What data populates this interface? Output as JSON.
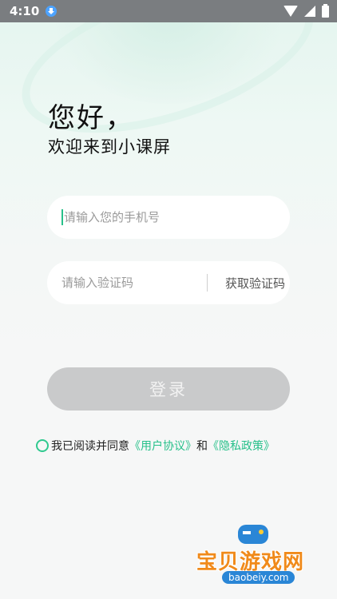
{
  "status_bar": {
    "time": "4:10",
    "icons": [
      "download-icon",
      "wifi-icon",
      "signal-icon",
      "battery-icon"
    ]
  },
  "greeting": "您好，",
  "subtitle": "欢迎来到小课屏",
  "phone_field": {
    "placeholder": "请输入您的手机号",
    "value": ""
  },
  "code_field": {
    "placeholder": "请输入验证码",
    "value": "",
    "get_code_label": "获取验证码"
  },
  "login_button": {
    "label": "登录"
  },
  "agreement": {
    "checked": false,
    "prefix": "我已阅读并同意",
    "user_agreement": "《用户协议》",
    "conjunction": "和",
    "privacy_policy": "《隐私政策》"
  },
  "watermark": {
    "title": "宝贝游戏网",
    "url": "baobeiy.com"
  },
  "colors": {
    "accent": "#27c08a",
    "button_disabled": "#c9cacb",
    "status_bar": "#7a7d80"
  }
}
